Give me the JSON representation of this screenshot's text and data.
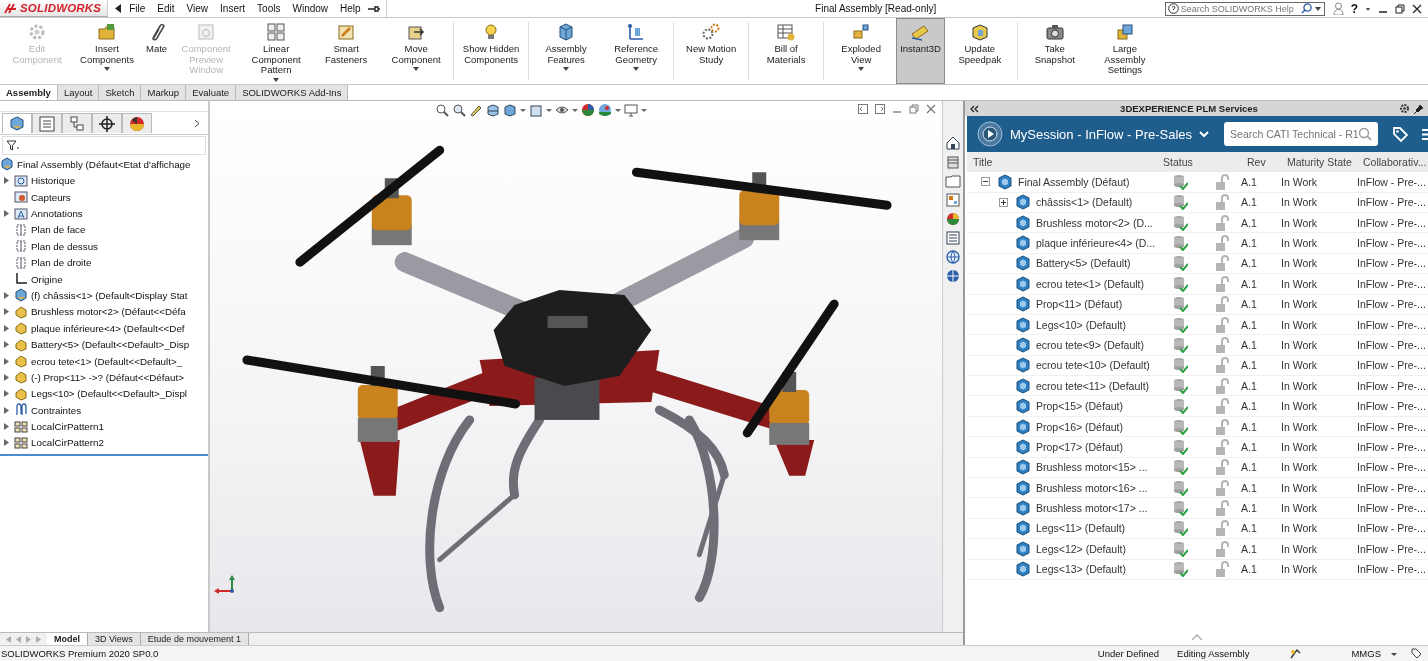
{
  "app": {
    "logo": "SOLIDWORKS",
    "menus": [
      "File",
      "Edit",
      "View",
      "Insert",
      "Tools",
      "Window",
      "Help"
    ],
    "title": "Final Assembly [Read-only]",
    "help_search": {
      "placeholder": "Search SOLIDWORKS Help"
    },
    "help_button": "?"
  },
  "ribbon": [
    {
      "label": "Edit Component",
      "disabled": true,
      "selected": false,
      "dropdown": false
    },
    {
      "label": "Insert Components",
      "disabled": false,
      "selected": false,
      "dropdown": true
    },
    {
      "label": "Mate",
      "disabled": false,
      "selected": false,
      "dropdown": false
    },
    {
      "label": "Component Preview Window",
      "disabled": true,
      "selected": false,
      "dropdown": false
    },
    {
      "label": "Linear Component Pattern",
      "disabled": false,
      "selected": false,
      "dropdown": true
    },
    {
      "label": "Smart Fasteners",
      "disabled": false,
      "selected": false,
      "dropdown": false
    },
    {
      "label": "Move Component",
      "disabled": false,
      "selected": false,
      "dropdown": true
    },
    {
      "label": "Show Hidden Components",
      "disabled": false,
      "selected": false,
      "dropdown": false
    },
    {
      "label": "Assembly Features",
      "disabled": false,
      "selected": false,
      "dropdown": true
    },
    {
      "label": "Reference Geometry",
      "disabled": false,
      "selected": false,
      "dropdown": true
    },
    {
      "label": "New Motion Study",
      "disabled": false,
      "selected": false,
      "dropdown": false
    },
    {
      "label": "Bill of Materials",
      "disabled": false,
      "selected": false,
      "dropdown": false
    },
    {
      "label": "Exploded View",
      "disabled": false,
      "selected": false,
      "dropdown": true
    },
    {
      "label": "Instant3D",
      "disabled": false,
      "selected": true,
      "dropdown": false
    },
    {
      "label": "Update Speedpak",
      "disabled": false,
      "selected": false,
      "dropdown": false
    },
    {
      "label": "Take Snapshot",
      "disabled": false,
      "selected": false,
      "dropdown": false
    },
    {
      "label": "Large Assembly Settings",
      "disabled": false,
      "selected": false,
      "dropdown": false
    }
  ],
  "tabs": [
    {
      "label": "Assembly",
      "selected": true
    },
    {
      "label": "Layout",
      "selected": false
    },
    {
      "label": "Sketch",
      "selected": false
    },
    {
      "label": "Markup",
      "selected": false
    },
    {
      "label": "Evaluate",
      "selected": false
    },
    {
      "label": "SOLIDWORKS Add-Ins",
      "selected": false
    }
  ],
  "feature_tree": {
    "panel_tabs": [
      {
        "selected": true
      },
      {
        "selected": false
      },
      {
        "selected": false
      },
      {
        "selected": false
      },
      {
        "selected": false
      }
    ],
    "root": {
      "label": "Final Assembly  (Défaut<Etat d'affichage",
      "children": [
        {
          "label": "Historique",
          "kind": "history",
          "expandable": true
        },
        {
          "label": "Capteurs",
          "kind": "sensors",
          "expandable": false
        },
        {
          "label": "Annotations",
          "kind": "annotations",
          "expandable": true
        },
        {
          "label": "Plan de face",
          "kind": "plane",
          "expandable": false
        },
        {
          "label": "Plan de dessus",
          "kind": "plane",
          "expandable": false
        },
        {
          "label": "Plan de droite",
          "kind": "plane",
          "expandable": false
        },
        {
          "label": "Origine",
          "kind": "origin",
          "expandable": false
        },
        {
          "label": "(f) châssis<1> (Default<Display Stat",
          "kind": "assembly",
          "expandable": true
        },
        {
          "label": "Brushless motor<2> (Défaut<<Défa",
          "kind": "part",
          "expandable": true
        },
        {
          "label": "plaque inférieure<4> (Default<<Def",
          "kind": "part",
          "expandable": true
        },
        {
          "label": "Battery<5> (Default<<Default>_Disp",
          "kind": "part",
          "expandable": true
        },
        {
          "label": "ecrou tete<1> (Default<<Default>_",
          "kind": "part",
          "expandable": true
        },
        {
          "label": "(-) Prop<11> ->? (Défaut<<Défaut>",
          "kind": "part",
          "expandable": true
        },
        {
          "label": "Legs<10> (Default<<Default>_Displ",
          "kind": "part",
          "expandable": true
        },
        {
          "label": "Contraintes",
          "kind": "mates",
          "expandable": true
        },
        {
          "label": "LocalCirPattern1",
          "kind": "pattern",
          "expandable": true
        },
        {
          "label": "LocalCirPattern2",
          "kind": "pattern",
          "expandable": true
        }
      ]
    }
  },
  "plm_panel": {
    "title": "3DEXPERIENCE PLM Services",
    "session": "MySession - InFlow - Pre-Sales",
    "search": {
      "placeholder": "Search CATI Technical - R1"
    },
    "columns": [
      "Title",
      "Status",
      "Rev",
      "Maturity State",
      "Collaborativ..."
    ],
    "rows": [
      {
        "title": "Final Assembly (Défaut)",
        "expanded": true,
        "rev": "A.1",
        "maturity": "In Work",
        "collab": "InFlow - Pre-...",
        "children": [
          {
            "title": "châssis<1> (Default)",
            "expanded": false,
            "rev": "A.1",
            "maturity": "In Work",
            "collab": "InFlow - Pre-..."
          },
          {
            "title": "Brushless motor<2> (D...",
            "rev": "A.1",
            "maturity": "In Work",
            "collab": "InFlow - Pre-..."
          },
          {
            "title": "plaque inférieure<4> (D...",
            "rev": "A.1",
            "maturity": "In Work",
            "collab": "InFlow - Pre-..."
          },
          {
            "title": "Battery<5> (Default)",
            "rev": "A.1",
            "maturity": "In Work",
            "collab": "InFlow - Pre-..."
          },
          {
            "title": "ecrou tete<1> (Default)",
            "rev": "A.1",
            "maturity": "In Work",
            "collab": "InFlow - Pre-..."
          },
          {
            "title": "Prop<11> (Défaut)",
            "rev": "A.1",
            "maturity": "In Work",
            "collab": "InFlow - Pre-..."
          },
          {
            "title": "Legs<10> (Default)",
            "rev": "A.1",
            "maturity": "In Work",
            "collab": "InFlow - Pre-..."
          },
          {
            "title": "ecrou tete<9> (Default)",
            "rev": "A.1",
            "maturity": "In Work",
            "collab": "InFlow - Pre-..."
          },
          {
            "title": "ecrou tete<10> (Default)",
            "rev": "A.1",
            "maturity": "In Work",
            "collab": "InFlow - Pre-..."
          },
          {
            "title": "ecrou tete<11> (Default)",
            "rev": "A.1",
            "maturity": "In Work",
            "collab": "InFlow - Pre-..."
          },
          {
            "title": "Prop<15> (Défaut)",
            "rev": "A.1",
            "maturity": "In Work",
            "collab": "InFlow - Pre-..."
          },
          {
            "title": "Prop<16> (Défaut)",
            "rev": "A.1",
            "maturity": "In Work",
            "collab": "InFlow - Pre-..."
          },
          {
            "title": "Prop<17> (Défaut)",
            "rev": "A.1",
            "maturity": "In Work",
            "collab": "InFlow - Pre-..."
          },
          {
            "title": "Brushless motor<15> ...",
            "rev": "A.1",
            "maturity": "In Work",
            "collab": "InFlow - Pre-..."
          },
          {
            "title": "Brushless motor<16> ...",
            "rev": "A.1",
            "maturity": "In Work",
            "collab": "InFlow - Pre-..."
          },
          {
            "title": "Brushless motor<17> ...",
            "rev": "A.1",
            "maturity": "In Work",
            "collab": "InFlow - Pre-..."
          },
          {
            "title": "Legs<11> (Default)",
            "rev": "A.1",
            "maturity": "In Work",
            "collab": "InFlow - Pre-..."
          },
          {
            "title": "Legs<12> (Default)",
            "rev": "A.1",
            "maturity": "In Work",
            "collab": "InFlow - Pre-..."
          },
          {
            "title": "Legs<13> (Default)",
            "rev": "A.1",
            "maturity": "In Work",
            "collab": "InFlow - Pre-..."
          }
        ]
      }
    ]
  },
  "bottom_tabs": [
    {
      "label": "Model",
      "selected": true
    },
    {
      "label": "3D Views",
      "selected": false
    },
    {
      "label": "Etude de mouvement 1",
      "selected": false
    }
  ],
  "status_bar": {
    "version": "SOLIDWORKS Premium 2020 SP0.0",
    "state": "Under Defined",
    "mode": "Editing Assembly",
    "units": "MMGS"
  }
}
